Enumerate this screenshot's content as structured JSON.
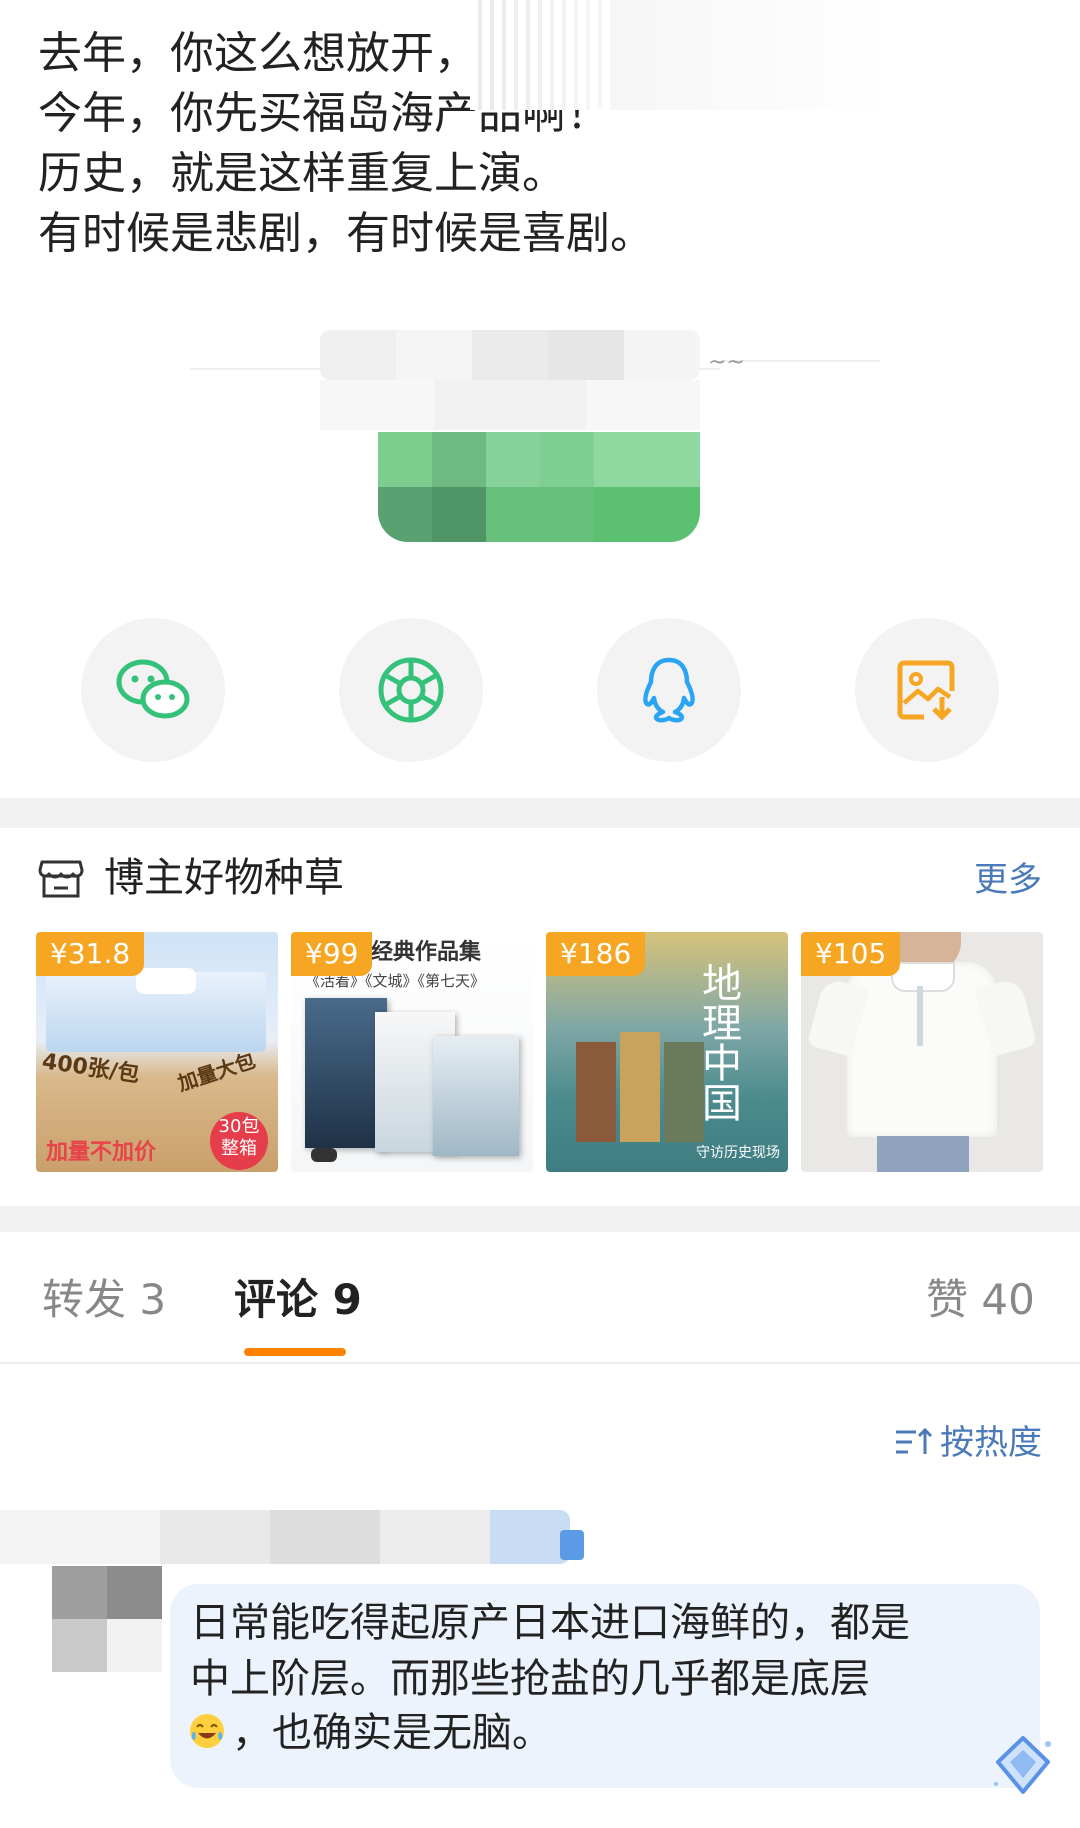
{
  "post": {
    "lines": [
      "去年，你这么想放开，",
      "今年，你先买福岛海产品啊！",
      "历史，就是这样重复上演。",
      "有时候是悲剧，有时候是喜剧。"
    ]
  },
  "share": {
    "buttons": [
      {
        "name": "wechat",
        "icon": "wechat-icon",
        "color": "#34c27a"
      },
      {
        "name": "moments",
        "icon": "moments-icon",
        "color": "#34c27a"
      },
      {
        "name": "qq",
        "icon": "qq-icon",
        "color": "#2aa4f4"
      },
      {
        "name": "save-image",
        "icon": "save-image-icon",
        "color": "#f6a623"
      }
    ]
  },
  "goods": {
    "title": "博主好物种草",
    "more": "更多",
    "items": [
      {
        "price": "¥31.8",
        "text1": "400张/包",
        "text2": "加量大包",
        "text3": "加量不加价",
        "badge": "30包\n整箱"
      },
      {
        "price": "¥99",
        "text1": "经典作品集",
        "text2": "《活着》《文城》《第七天》"
      },
      {
        "price": "¥186",
        "text1": "地理中国",
        "text2": "守访历史现场"
      },
      {
        "price": "¥105"
      }
    ]
  },
  "tabs": {
    "repost": "转发 3",
    "comment": "评论 9",
    "like": "赞 40"
  },
  "sort": {
    "label": "按热度"
  },
  "comment": {
    "lines": [
      "日常能吃得起原产日本进口海鲜的，都是",
      "中上阶层。而那些抢盐的几乎都是底层",
      "，也确实是无脑。"
    ]
  },
  "colors": {
    "accent": "#ff8200",
    "link": "#4a7ab8",
    "price": "#f6a623"
  }
}
